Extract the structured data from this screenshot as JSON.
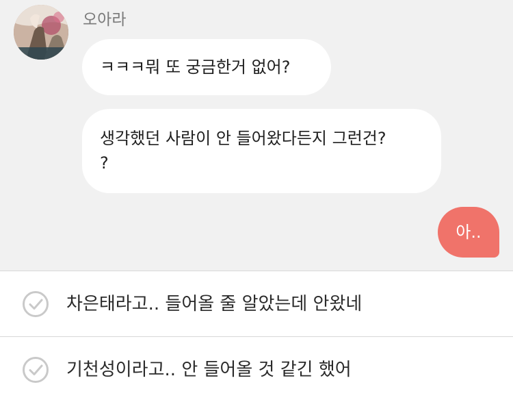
{
  "chat": {
    "sender_name": "오아라",
    "messages": [
      {
        "from": "other",
        "text": "ㅋㅋㅋ뭐 또 궁금한거 없어?"
      },
      {
        "from": "other",
        "text": "생각했던 사람이 안 들어왔다든지 그런건?\n?"
      },
      {
        "from": "me",
        "text": "아.."
      }
    ]
  },
  "options": [
    {
      "label": "차은태라고.. 들어올 줄 알았는데 안왔네",
      "icon": "check-circle-icon"
    },
    {
      "label": "기천성이라고.. 안 들어올 것 같긴 했어",
      "icon": "check-circle-icon"
    }
  ],
  "colors": {
    "chat_background": "#f1f1f1",
    "my_bubble": "#f0736a",
    "other_bubble": "#ffffff"
  }
}
